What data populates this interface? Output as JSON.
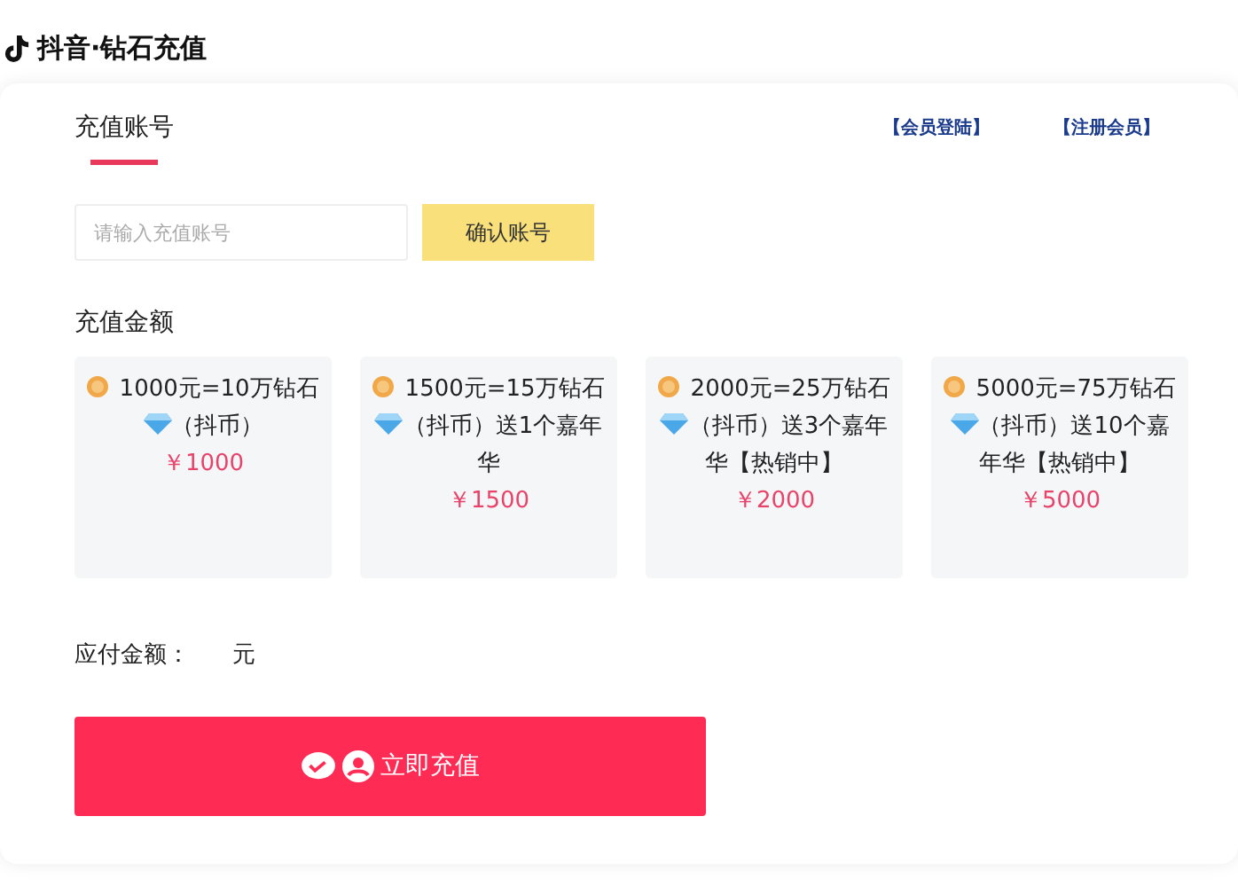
{
  "header": {
    "title": "抖音·钻石充值"
  },
  "tabs": [
    {
      "label": "充值账号",
      "selected": true
    }
  ],
  "links": [
    "【会员登陆】",
    "【注册会员】"
  ],
  "account": {
    "placeholder": "请输入充值账号",
    "confirm": "确认账号"
  },
  "amount_section": {
    "title": "充值金额"
  },
  "offers": [
    {
      "text_start": "1000元=10万钻石",
      "text_end": "（抖币）",
      "price": "￥1000"
    },
    {
      "text_start": "1500元=15万钻石",
      "text_end": "（抖币）送1个嘉年华",
      "price": "￥1500"
    },
    {
      "text_start": "2000元=25万钻石",
      "text_end": "（抖币）送3个嘉年华【热销中】",
      "price": "￥2000"
    },
    {
      "text_start": "5000元=75万钻石",
      "text_end": "（抖币）送10个嘉年华【热销中】",
      "price": "￥5000"
    }
  ],
  "payable": {
    "label": "应付金额：",
    "unit": "元"
  },
  "pay_button": "立即充值"
}
